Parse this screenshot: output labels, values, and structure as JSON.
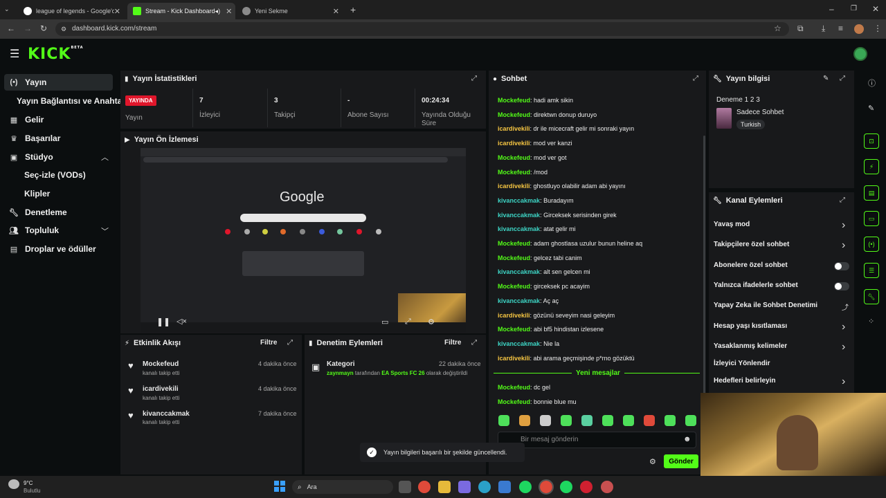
{
  "browser": {
    "tabs": [
      {
        "title": "league of legends - Google'da",
        "icon": "google-icon"
      },
      {
        "title": "Stream - Kick Dashboard",
        "icon": "kick-icon"
      },
      {
        "title": "Yeni Sekme",
        "icon": "chrome-icon"
      }
    ],
    "url": "dashboard.kick.com/stream"
  },
  "app": {
    "logo": "KICK",
    "logo_badge": "BETA"
  },
  "sidebar": {
    "items": [
      {
        "label": "Yayın",
        "icon": "broadcast-icon"
      },
      {
        "label": "Yayın Bağlantısı ve Anahtarı",
        "icon": ""
      },
      {
        "label": "Gelir",
        "icon": "revenue-icon"
      },
      {
        "label": "Başarılar",
        "icon": "trophy-icon"
      },
      {
        "label": "Stüdyo",
        "icon": "studio-icon"
      },
      {
        "label": "Seç-izle (VODs)",
        "icon": ""
      },
      {
        "label": "Klipler",
        "icon": ""
      },
      {
        "label": "Denetleme",
        "icon": "wrench-icon"
      },
      {
        "label": "Topluluk",
        "icon": "users-icon"
      },
      {
        "label": "Droplar ve ödüller",
        "icon": "gift-icon"
      }
    ]
  },
  "stats": {
    "title": "Yayın İstatistikleri",
    "live_badge": "YAYINDA",
    "items": [
      {
        "value": "",
        "label": "Yayın"
      },
      {
        "value": "7",
        "label": "İzleyici"
      },
      {
        "value": "3",
        "label": "Takipçi"
      },
      {
        "value": "-",
        "label": "Abone Sayısı"
      },
      {
        "value": "00:24:34",
        "label": "Yayında Olduğu Süre"
      }
    ]
  },
  "preview": {
    "title": "Yayın Ön İzlemesi",
    "google_logo": "Google"
  },
  "activity": {
    "title": "Etkinlik Akışı",
    "filter": "Filtre",
    "items": [
      {
        "user": "Mockefeud",
        "text": "kanalı takip etti",
        "time": "4 dakika önce"
      },
      {
        "user": "icardivekili",
        "text": "kanalı takip etti",
        "time": "4 dakika önce"
      },
      {
        "user": "kivanccakmak",
        "text": "kanalı takip etti",
        "time": "7 dakika önce"
      }
    ]
  },
  "moderation": {
    "title": "Denetim Eylemleri",
    "filter": "Filtre",
    "item": {
      "heading": "Kategori",
      "time": "22 dakika önce",
      "user": "zaynmayn",
      "text_mid": "tarafından",
      "category": "EA Sports FC 26",
      "text_end": "olarak değiştirildi"
    }
  },
  "chat": {
    "title": "Sohbet",
    "messages": [
      {
        "user": "Mockefeud",
        "text": "hadi amk sikin",
        "c": "m"
      },
      {
        "user": "Mockefeud",
        "text": "direktwn donup duruyo",
        "c": "m"
      },
      {
        "user": "icardivekili",
        "text": "dr ile micecraft gelir mi sonraki yayın",
        "c": "i"
      },
      {
        "user": "icardivekili",
        "text": "mod ver kanzi",
        "c": "i"
      },
      {
        "user": "Mockefeud",
        "text": "mod ver got",
        "c": "m"
      },
      {
        "user": "Mockefeud",
        "text": "/mod",
        "c": "m"
      },
      {
        "user": "icardivekili",
        "text": "ghostluyo olabilir adam abi yayını",
        "c": "i"
      },
      {
        "user": "kivanccakmak",
        "text": "Buradayım",
        "c": "k"
      },
      {
        "user": "kivanccakmak",
        "text": "Girceksek serisinden girek",
        "c": "k"
      },
      {
        "user": "kivanccakmak",
        "text": "atat gelir mi",
        "c": "k"
      },
      {
        "user": "Mockefeud",
        "text": "adam ghostlasa uzulur bunun heline aq",
        "c": "m"
      },
      {
        "user": "Mockefeud",
        "text": "gelcez tabi canim",
        "c": "m"
      },
      {
        "user": "kivanccakmak",
        "text": "alt sen gelcen mi",
        "c": "k"
      },
      {
        "user": "Mockefeud",
        "text": "girceksek pc acayim",
        "c": "m"
      },
      {
        "user": "kivanccakmak",
        "text": "Aç aç",
        "c": "k"
      },
      {
        "user": "icardivekili",
        "text": "gözünü seveyim nasi geleyim",
        "c": "i"
      },
      {
        "user": "Mockefeud",
        "text": "abi bf5 hindistan izlesene",
        "c": "m"
      },
      {
        "user": "kivanccakmak",
        "text": "Nie la",
        "c": "k"
      },
      {
        "user": "icardivekili",
        "text": "abi arama geçmişinde p*rno gözüktü",
        "c": "i"
      }
    ],
    "new_divider": "Yeni mesajlar",
    "new_messages": [
      {
        "user": "Mockefeud",
        "text": "dc gel",
        "c": "m"
      },
      {
        "user": "Mockefeud",
        "text": "bonnie blue mu",
        "c": "m"
      }
    ],
    "input_placeholder": "Bir mesaj gönderin",
    "send": "Gönder"
  },
  "stream_info": {
    "title": "Yayın bilgisi",
    "stream_title": "Deneme 1 2 3",
    "chat_mode": "Sadece Sohbet",
    "language": "Turkish"
  },
  "channel_actions": {
    "title": "Kanal Eylemleri",
    "items": [
      {
        "label": "Yavaş mod",
        "kind": "chevron"
      },
      {
        "label": "Takipçilere özel sohbet",
        "kind": "chevron"
      },
      {
        "label": "Abonelere özel sohbet",
        "kind": "toggle"
      },
      {
        "label": "Yalnızca ifadelerle sohbet",
        "kind": "toggle"
      },
      {
        "label": "Yapay Zeka ile Sohbet Denetimi",
        "kind": "link"
      },
      {
        "label": "Hesap yaşı kısıtlaması",
        "kind": "chevron"
      },
      {
        "label": "Yasaklanmış kelimeler",
        "kind": "chevron"
      },
      {
        "label": "İzleyici Yönlendir",
        "kind": "none"
      },
      {
        "label": "Hedefleri belirleyin",
        "kind": "chevron"
      }
    ]
  },
  "toast": {
    "text": "Yayın bilgileri başarılı bir şekilde güncellendi."
  },
  "taskbar": {
    "weather_temp": "9°C",
    "weather_desc": "Bulutlu",
    "search": "Ara"
  },
  "colors": {
    "accent": "#53fc18",
    "panel": "#18191b",
    "background": "#0b0e0f",
    "live": "#e0162b"
  }
}
